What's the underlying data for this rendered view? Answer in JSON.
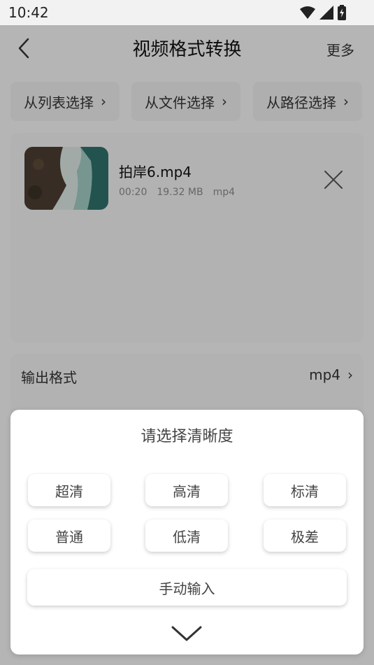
{
  "status": {
    "time": "10:42"
  },
  "header": {
    "title": "视频格式转换",
    "more_label": "更多"
  },
  "sources": [
    {
      "label": "从列表选择"
    },
    {
      "label": "从文件选择"
    },
    {
      "label": "从路径选择"
    }
  ],
  "file": {
    "name": "拍岸6.mp4",
    "duration": "00:20",
    "size": "19.32 MB",
    "format": "mp4"
  },
  "settings": {
    "output_format_label": "输出格式",
    "output_format_value": "mp4"
  },
  "sheet": {
    "title": "请选择清晰度",
    "options": [
      "超清",
      "高清",
      "标清",
      "普通",
      "低清",
      "极差"
    ],
    "manual_label": "手动输入"
  }
}
